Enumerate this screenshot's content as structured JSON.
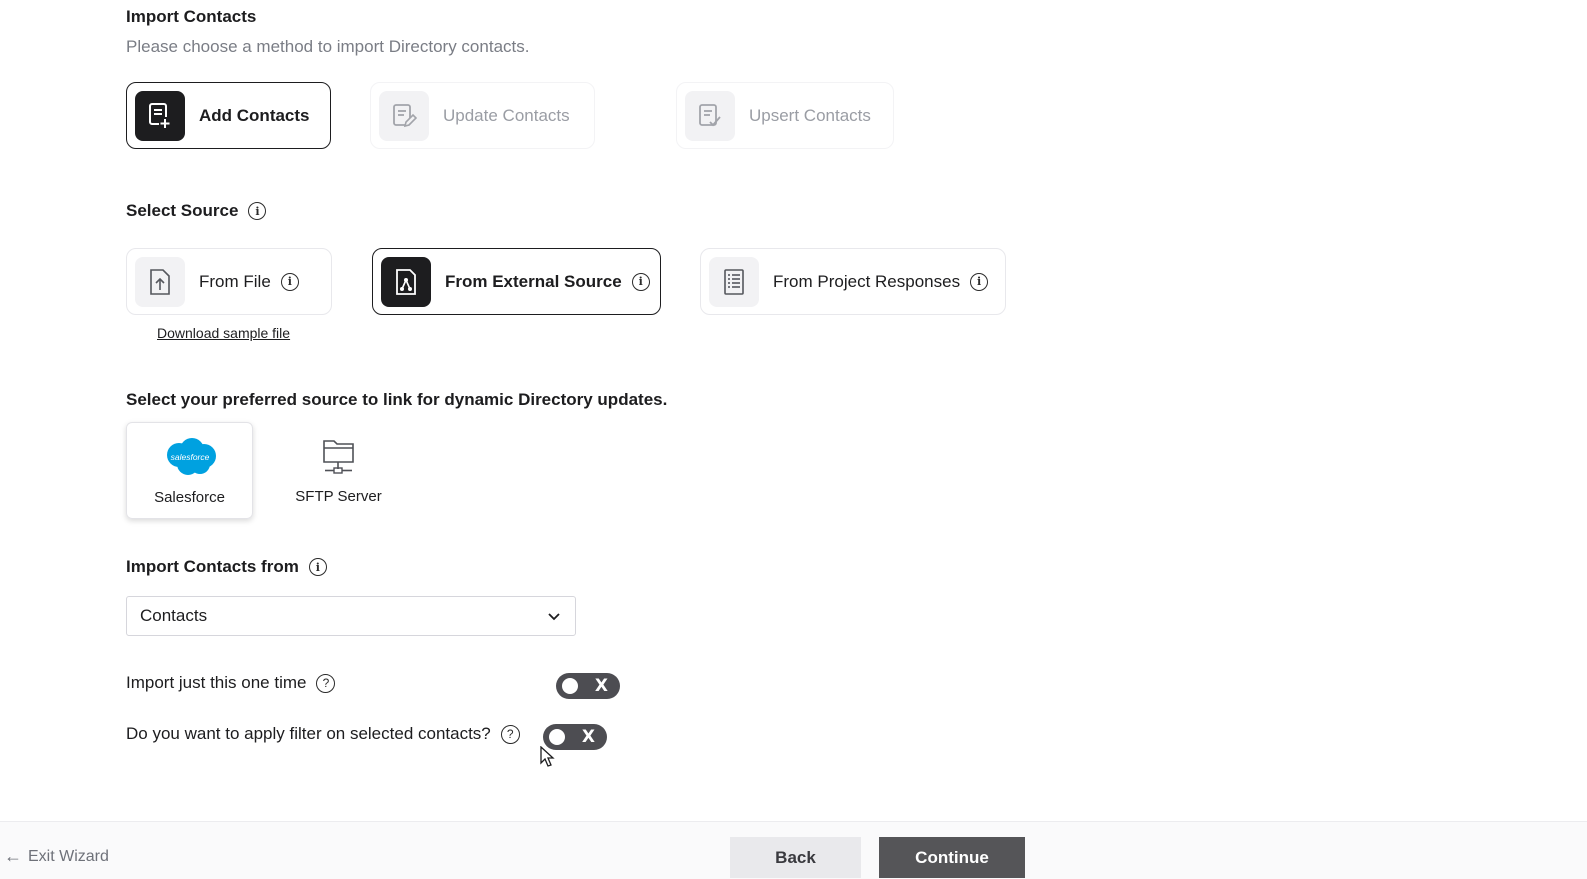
{
  "import": {
    "title": "Import Contacts",
    "subtitle": "Please choose a method to import Directory contacts."
  },
  "methods": [
    {
      "label": "Add Contacts",
      "icon": "add-contact-icon",
      "state": "selected"
    },
    {
      "label": "Update Contacts",
      "icon": "edit-contact-icon",
      "state": "disabled"
    },
    {
      "label": "Upsert Contacts",
      "icon": "upsert-contact-icon",
      "state": "disabled"
    }
  ],
  "source": {
    "title": "Select Source",
    "options": [
      {
        "label": "From File",
        "icon": "upload-file-icon",
        "state": "idle"
      },
      {
        "label": "From External Source",
        "icon": "external-source-icon",
        "state": "selected"
      },
      {
        "label": "From Project Responses",
        "icon": "project-responses-icon",
        "state": "idle"
      }
    ],
    "download_link": "Download sample file"
  },
  "preferred": {
    "title": "Select your preferred source to link for dynamic Directory updates.",
    "tiles": [
      {
        "label": "Salesforce",
        "logo_text": "salesforce",
        "selected": true
      },
      {
        "label": "SFTP Server",
        "selected": false
      }
    ]
  },
  "import_from": {
    "title": "Import Contacts from",
    "value": "Contacts"
  },
  "options": {
    "one_time": {
      "label": "Import just this one time",
      "toggle_mark": "X",
      "on": false
    },
    "apply_filter": {
      "label": "Do you want to apply filter on selected contacts?",
      "toggle_mark": "X",
      "on": false
    }
  },
  "footer": {
    "exit_label": "Exit Wizard",
    "back_label": "Back",
    "continue_label": "Continue"
  },
  "colors": {
    "accent_dark": "#1d1d1f",
    "muted_text": "#7a7d85",
    "salesforce_blue": "#00a1e0",
    "continue_bg": "#555558"
  }
}
